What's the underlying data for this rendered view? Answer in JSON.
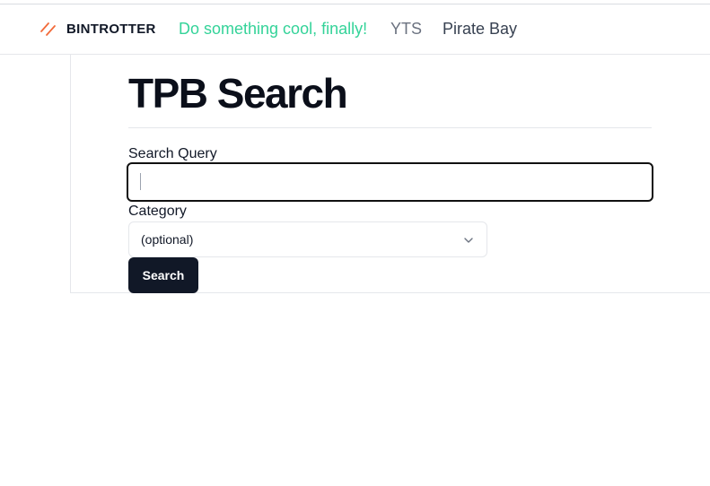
{
  "navbar": {
    "brand": "BINTROTTER",
    "brand_icon": "slashes-logo-icon",
    "brand_icon_color": "#f26b3a",
    "links": [
      {
        "label": "Do something cool, finally!",
        "color": "#34d399"
      },
      {
        "label": "YTS",
        "color": "#6b7280"
      },
      {
        "label": "Pirate Bay",
        "color": "#374151"
      }
    ]
  },
  "main": {
    "title": "TPB Search",
    "search": {
      "label": "Search Query",
      "value": ""
    },
    "category": {
      "label": "Category",
      "selected": "(optional)",
      "icon": "chevron-down-icon"
    },
    "submit_label": "Search"
  }
}
